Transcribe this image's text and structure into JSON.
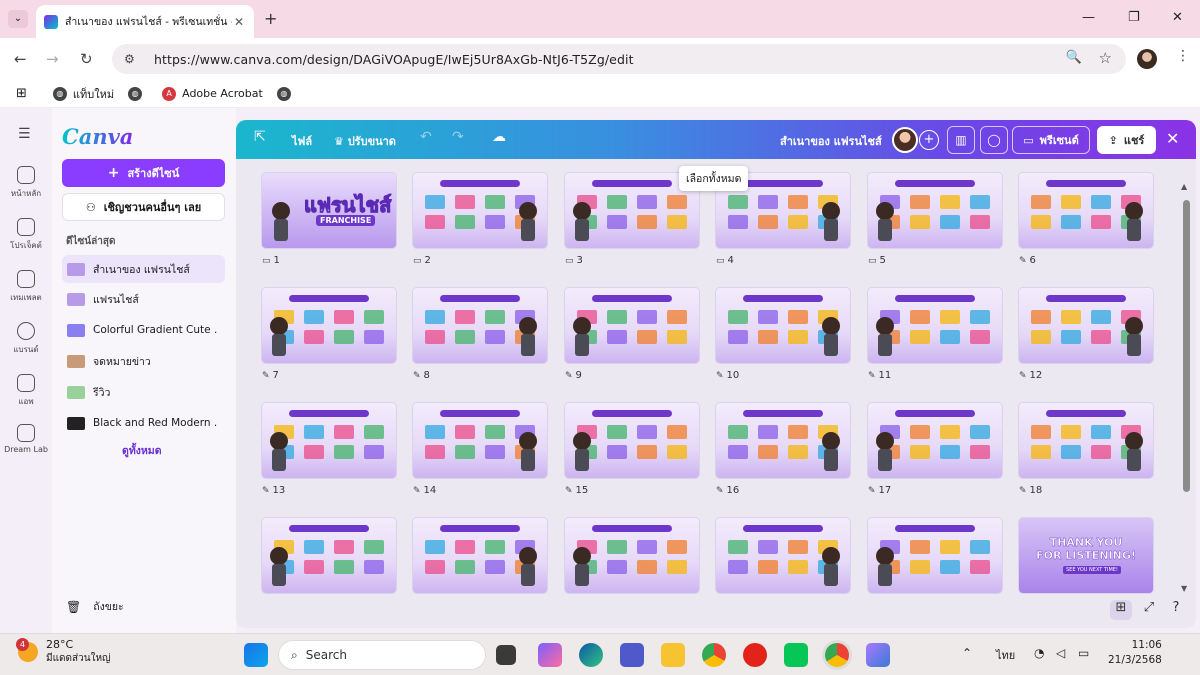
{
  "browser": {
    "tab_title": "สำเนาของ แฟรนไชส์ - พรีเซนเทชั่น - Canva",
    "url": "https://www.canva.com/design/DAGiVOApugE/IwEj5Ur8AxGb-NtJ6-T5Zg/edit",
    "bookmarks": [
      "แท็บใหม่",
      "",
      "Adobe Acrobat",
      ""
    ]
  },
  "rail": {
    "items": [
      {
        "label": "หน้าหลัก",
        "icon": "home-icon"
      },
      {
        "label": "โปรเจ็คต์",
        "icon": "folder-icon"
      },
      {
        "label": "เทมเพลต",
        "icon": "template-icon"
      },
      {
        "label": "แบรนด์",
        "icon": "brand-icon"
      },
      {
        "label": "แอพ",
        "icon": "apps-icon"
      },
      {
        "label": "Dream Lab",
        "icon": "dream-lab-icon"
      }
    ]
  },
  "sidebar": {
    "logo": "Canva",
    "create_label": "สร้างดีไซน์",
    "invite_label": "เชิญชวนคนอื่นๆ เลย",
    "recent_heading": "ดีไซน์ล่าสุด",
    "recent": [
      {
        "name": "สำเนาของ แฟรนไชส์",
        "color": "#b89be8"
      },
      {
        "name": "แฟรนไชส์",
        "color": "#b89be8"
      },
      {
        "name": "Colorful Gradient Cute ...",
        "color": "#8a7ff0"
      },
      {
        "name": "จดหมายข่าว",
        "color": "#c79a78"
      },
      {
        "name": "รีวิว",
        "color": "#9ad19a"
      },
      {
        "name": "Black and Red Modern ...",
        "color": "#222222"
      }
    ],
    "see_all": "ดูทั้งหมด",
    "trash": "ถังขยะ"
  },
  "editor": {
    "file_label": "ไฟล์",
    "resize_label": "ปรับขนาด",
    "doc_title": "สำเนาของ แฟรนไชส์",
    "present_label": "พรีเซนต์",
    "share_label": "แชร์",
    "tooltip": "เลือกทั้งหมด"
  },
  "slides": [
    {
      "n": "1",
      "icon": "comment"
    },
    {
      "n": "2",
      "icon": "comment"
    },
    {
      "n": "3",
      "icon": "comment"
    },
    {
      "n": "4",
      "icon": "comment"
    },
    {
      "n": "5",
      "icon": "comment"
    },
    {
      "n": "6",
      "icon": "edit"
    },
    {
      "n": "7",
      "icon": "edit"
    },
    {
      "n": "8",
      "icon": "edit"
    },
    {
      "n": "9",
      "icon": "edit"
    },
    {
      "n": "10",
      "icon": "edit"
    },
    {
      "n": "11",
      "icon": "edit"
    },
    {
      "n": "12",
      "icon": "edit"
    },
    {
      "n": "13",
      "icon": "edit"
    },
    {
      "n": "14",
      "icon": "edit"
    },
    {
      "n": "15",
      "icon": "edit"
    },
    {
      "n": "16",
      "icon": "edit"
    },
    {
      "n": "17",
      "icon": "edit"
    },
    {
      "n": "18",
      "icon": "edit"
    },
    {
      "n": "",
      "icon": ""
    },
    {
      "n": "",
      "icon": ""
    },
    {
      "n": "",
      "icon": ""
    },
    {
      "n": "",
      "icon": ""
    },
    {
      "n": "",
      "icon": ""
    },
    {
      "n": "",
      "icon": ""
    }
  ],
  "slide_text": {
    "title_big": "แฟรนไชส์",
    "title_sub": "FRANCHISE",
    "thanks_line1": "THANK YOU",
    "thanks_line2": "FOR LISTENING!",
    "thanks_small": "SEE YOU NEXT TIME!"
  },
  "taskbar": {
    "temp": "28°C",
    "weather_desc": "มีแดดส่วนใหญ่",
    "weather_badge": "4",
    "search_label": "Search",
    "lang": "ไทย",
    "time": "11:06",
    "date": "21/3/2568"
  }
}
